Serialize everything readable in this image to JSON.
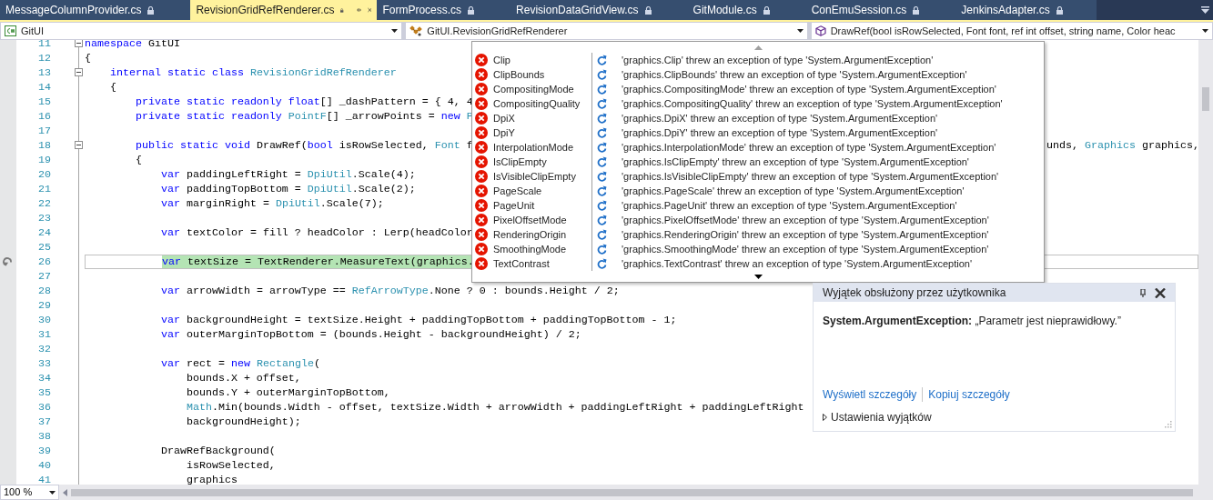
{
  "tabs": [
    {
      "label": "MessageColumnProvider.cs",
      "selected": false
    },
    {
      "label": "RevisionGridRefRenderer.cs",
      "selected": true
    },
    {
      "label": "FormProcess.cs",
      "selected": false
    },
    {
      "label": "RevisionDataGridView.cs",
      "selected": false
    },
    {
      "label": "GitModule.cs",
      "selected": false
    },
    {
      "label": "ConEmuSession.cs",
      "selected": false
    },
    {
      "label": "JenkinsAdapter.cs",
      "selected": false
    }
  ],
  "navigation_bar": [
    {
      "kind": "project",
      "text": "GitUI"
    },
    {
      "kind": "class",
      "text": "GitUI.RevisionGridRefRenderer"
    },
    {
      "kind": "member",
      "text": "DrawRef(bool isRowSelected, Font font, ref int offset, string name, Color heac"
    }
  ],
  "editor": {
    "lines": [
      {
        "number": "11",
        "current": false,
        "expanded": true,
        "tokens": [
          {
            "kind": "keyword",
            "text": "namespace"
          },
          {
            "kind": "plain",
            "text": " GitUI"
          }
        ]
      },
      {
        "number": "12",
        "current": false,
        "tokens": [
          {
            "kind": "plain",
            "text": "{"
          }
        ]
      },
      {
        "number": "13",
        "current": false,
        "expanded": true,
        "tokens": [
          {
            "kind": "keyword",
            "text": "    internal static class"
          },
          {
            "kind": "type",
            "text": " RevisionGridRefRenderer"
          }
        ]
      },
      {
        "number": "14",
        "current": false,
        "tokens": [
          {
            "kind": "plain",
            "text": "    {"
          }
        ]
      },
      {
        "number": "15",
        "current": false,
        "tokens": [
          {
            "kind": "keyword",
            "text": "        private static readonly float"
          },
          {
            "kind": "plain",
            "text": "[] _dashPattern = { 4, 4"
          }
        ]
      },
      {
        "number": "16",
        "current": false,
        "tokens": [
          {
            "kind": "keyword",
            "text": "        private static readonly"
          },
          {
            "kind": "type",
            "text": " PointF"
          },
          {
            "kind": "plain",
            "text": "[] _arrowPoints = "
          },
          {
            "kind": "keyword",
            "text": "new"
          },
          {
            "kind": "type",
            "text": " P"
          }
        ]
      },
      {
        "number": "17",
        "current": false
      },
      {
        "number": "18",
        "current": false,
        "expanded": true,
        "tokens": [
          {
            "kind": "keyword",
            "text": "        public static void"
          },
          {
            "kind": "plain",
            "text": " DrawRef("
          },
          {
            "kind": "keyword",
            "text": "bool"
          },
          {
            "kind": "plain",
            "text": " isRowSelected, "
          },
          {
            "kind": "type",
            "text": "Font"
          },
          {
            "kind": "plain",
            "text": " f"
          }
        ],
        "tokens_after_popup": [
          {
            "kind": "plain",
            "text": "unds, "
          },
          {
            "kind": "type",
            "text": "Graphics"
          },
          {
            "kind": "plain",
            "text": " graphics,"
          }
        ]
      },
      {
        "number": "19",
        "current": false,
        "tokens": [
          {
            "kind": "plain",
            "text": "        {"
          }
        ]
      },
      {
        "number": "20",
        "current": false,
        "tokens": [
          {
            "kind": "keyword",
            "text": "            var"
          },
          {
            "kind": "plain",
            "text": " paddingLeftRight = "
          },
          {
            "kind": "type",
            "text": "DpiUtil"
          },
          {
            "kind": "plain",
            "text": ".Scale(4);"
          }
        ]
      },
      {
        "number": "21",
        "current": false,
        "tokens": [
          {
            "kind": "keyword",
            "text": "            var"
          },
          {
            "kind": "plain",
            "text": " paddingTopBottom = "
          },
          {
            "kind": "type",
            "text": "DpiUtil"
          },
          {
            "kind": "plain",
            "text": ".Scale(2);"
          }
        ]
      },
      {
        "number": "22",
        "current": false,
        "tokens": [
          {
            "kind": "keyword",
            "text": "            var"
          },
          {
            "kind": "plain",
            "text": " marginRight = "
          },
          {
            "kind": "type",
            "text": "DpiUtil"
          },
          {
            "kind": "plain",
            "text": ".Scale(7);"
          }
        ]
      },
      {
        "number": "23",
        "current": false
      },
      {
        "number": "24",
        "current": false,
        "tokens": [
          {
            "kind": "keyword",
            "text": "            var"
          },
          {
            "kind": "plain",
            "text": " textColor = fill ? headColor : Lerp(headColor"
          }
        ]
      },
      {
        "number": "25",
        "current": false
      },
      {
        "number": "26",
        "current": true,
        "tokens": [
          {
            "kind": "keyword",
            "text": "            var"
          },
          {
            "kind": "plain",
            "text": " textSize = TextRenderer.MeasureText(graphics."
          }
        ]
      },
      {
        "number": "27",
        "current": false
      },
      {
        "number": "28",
        "current": false,
        "tokens": [
          {
            "kind": "keyword",
            "text": "            var"
          },
          {
            "kind": "plain",
            "text": " arrowWidth = arrowType == "
          },
          {
            "kind": "type",
            "text": "RefArrowType"
          },
          {
            "kind": "plain",
            "text": ".None ? 0 : bounds.Height / 2;"
          }
        ]
      },
      {
        "number": "29",
        "current": false
      },
      {
        "number": "30",
        "current": false,
        "tokens": [
          {
            "kind": "keyword",
            "text": "            var"
          },
          {
            "kind": "plain",
            "text": " backgroundHeight = textSize.Height + paddingTopBottom + paddingTopBottom - 1;"
          }
        ]
      },
      {
        "number": "31",
        "current": false,
        "tokens": [
          {
            "kind": "keyword",
            "text": "            var"
          },
          {
            "kind": "plain",
            "text": " outerMarginTopBottom = (bounds.Height - backgroundHeight) / 2;"
          }
        ]
      },
      {
        "number": "32",
        "current": false
      },
      {
        "number": "33",
        "current": false,
        "tokens": [
          {
            "kind": "keyword",
            "text": "            var"
          },
          {
            "kind": "plain",
            "text": " rect = "
          },
          {
            "kind": "keyword",
            "text": "new"
          },
          {
            "kind": "type",
            "text": " Rectangle"
          },
          {
            "kind": "plain",
            "text": "("
          }
        ]
      },
      {
        "number": "34",
        "current": false,
        "tokens": [
          {
            "kind": "plain",
            "text": "                bounds.X + offset,"
          }
        ]
      },
      {
        "number": "35",
        "current": false,
        "tokens": [
          {
            "kind": "plain",
            "text": "                bounds.Y + outerMarginTopBottom,"
          }
        ]
      },
      {
        "number": "36",
        "current": false,
        "tokens": [
          {
            "kind": "type",
            "text": "                Math"
          },
          {
            "kind": "plain",
            "text": ".Min(bounds.Width - offset, textSize.Width + arrowWidth + paddingLeftRight + paddingLeftRight"
          }
        ]
      },
      {
        "number": "37",
        "current": false,
        "tokens": [
          {
            "kind": "plain",
            "text": "                backgroundHeight);"
          }
        ]
      },
      {
        "number": "38",
        "current": false
      },
      {
        "number": "39",
        "current": false,
        "tokens": [
          {
            "kind": "plain",
            "text": "            DrawRefBackground("
          }
        ]
      },
      {
        "number": "40",
        "current": false,
        "tokens": [
          {
            "kind": "plain",
            "text": "                isRowSelected,"
          }
        ]
      },
      {
        "number": "41",
        "current": false,
        "tokens": [
          {
            "kind": "plain",
            "text": "                graphics"
          }
        ]
      }
    ]
  },
  "datatip": {
    "items": [
      {
        "name": "Clip",
        "value": "'graphics.Clip' threw an exception of type 'System.ArgumentException'"
      },
      {
        "name": "ClipBounds",
        "value": "'graphics.ClipBounds' threw an exception of type 'System.ArgumentException'"
      },
      {
        "name": "CompositingMode",
        "value": "'graphics.CompositingMode' threw an exception of type 'System.ArgumentException'"
      },
      {
        "name": "CompositingQuality",
        "value": "'graphics.CompositingQuality' threw an exception of type 'System.ArgumentException'"
      },
      {
        "name": "DpiX",
        "value": "'graphics.DpiX' threw an exception of type 'System.ArgumentException'"
      },
      {
        "name": "DpiY",
        "value": "'graphics.DpiY' threw an exception of type 'System.ArgumentException'"
      },
      {
        "name": "InterpolationMode",
        "value": "'graphics.InterpolationMode' threw an exception of type 'System.ArgumentException'"
      },
      {
        "name": "IsClipEmpty",
        "value": "'graphics.IsClipEmpty' threw an exception of type 'System.ArgumentException'"
      },
      {
        "name": "IsVisibleClipEmpty",
        "value": "'graphics.IsVisibleClipEmpty' threw an exception of type 'System.ArgumentException'"
      },
      {
        "name": "PageScale",
        "value": "'graphics.PageScale' threw an exception of type 'System.ArgumentException'"
      },
      {
        "name": "PageUnit",
        "value": "'graphics.PageUnit' threw an exception of type 'System.ArgumentException'"
      },
      {
        "name": "PixelOffsetMode",
        "value": "'graphics.PixelOffsetMode' threw an exception of type 'System.ArgumentException'"
      },
      {
        "name": "RenderingOrigin",
        "value": "'graphics.RenderingOrigin' threw an exception of type 'System.ArgumentException'"
      },
      {
        "name": "SmoothingMode",
        "value": "'graphics.SmoothingMode' threw an exception of type 'System.ArgumentException'"
      },
      {
        "name": "TextContrast",
        "value": "'graphics.TextContrast' threw an exception of type 'System.ArgumentException'"
      }
    ]
  },
  "exception_helper": {
    "title": "Wyjątek obsłużony przez użytkownika",
    "message": "**System.ArgumentException:** „Parametr jest nieprawidłowy.”",
    "links": [
      "Wyświetl szczegóły",
      "Kopiuj szczegóły"
    ],
    "settings": {
      "label": "Ustawienia wyjątków",
      "expanded": false
    }
  },
  "zoom": "100 %"
}
